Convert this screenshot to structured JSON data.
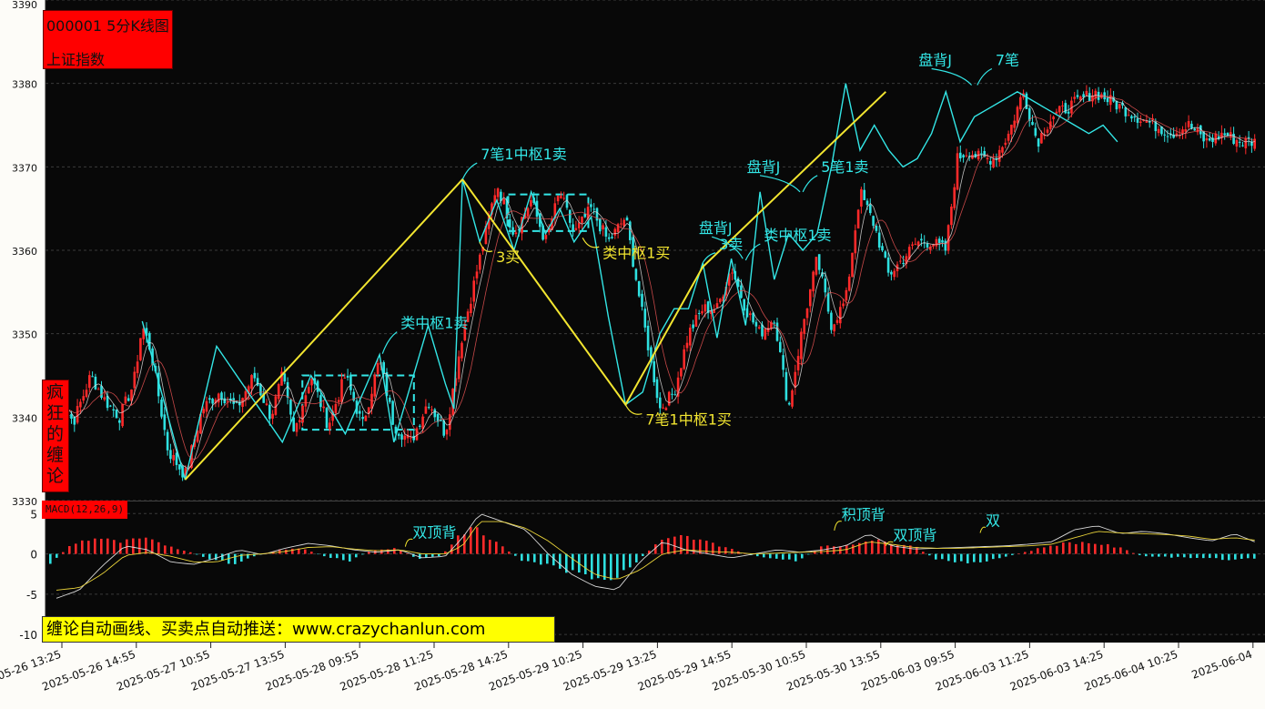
{
  "header": {
    "code_title": "000001 5分K线图",
    "index_name": "上证指数"
  },
  "side_label": "疯狂的缠论",
  "promo_text": "缠论自动画线、买卖点自动推送：www.crazychanlun.com",
  "macd_label": "MACD(12,26,9)",
  "colors": {
    "background": "#080808",
    "up": "#ff2a2a",
    "down": "#2ee0e0",
    "bi": "#33e6e6",
    "segment": "#f2e530",
    "label_red": "#ff0000",
    "promo_yellow": "#ffff00"
  },
  "chart_data": [
    {
      "type": "candlestick",
      "ylim": [
        3330,
        3390
      ],
      "yticks": [
        "3390",
        "3380",
        "3370",
        "3360",
        "3350",
        "3340",
        "3330"
      ],
      "xticks": [
        "2025-05-26 13:25",
        "2025-05-26 14:55",
        "2025-05-27 10:55",
        "2025-05-27 13:55",
        "2025-05-28 09:55",
        "2025-05-28 11:25",
        "2025-05-28 14:25",
        "2025-05-29 10:25",
        "2025-05-29 13:25",
        "2025-05-29 14:55",
        "2025-05-30 10:55",
        "2025-05-30 13:55",
        "2025-06-03 09:55",
        "2025-06-03 11:25",
        "2025-06-03 14:25",
        "2025-06-04 10:25",
        "2025-06-04"
      ],
      "price_path_x": [
        0,
        6,
        12,
        17,
        22,
        27,
        30,
        33,
        39,
        45,
        51,
        57,
        63,
        69,
        75,
        79,
        83,
        89,
        95,
        101,
        107,
        113,
        118,
        124,
        130,
        136,
        142,
        148,
        154,
        160,
        166,
        171,
        176,
        181,
        187,
        193,
        199,
        205,
        211,
        216,
        221,
        226,
        231,
        236,
        241,
        246,
        251,
        256,
        261,
        266,
        271,
        276,
        281,
        286,
        291,
        296,
        301,
        306,
        311,
        315,
        319,
        323,
        328,
        333,
        338,
        343,
        348,
        353,
        358,
        363,
        368,
        373,
        378,
        384,
        390,
        396,
        402,
        408,
        414,
        419
      ],
      "price_path_y": [
        3342,
        3339.5,
        3345,
        3342,
        3340,
        3344,
        3351,
        3348,
        3336,
        3333,
        3341,
        3343,
        3341,
        3345,
        3340,
        3345,
        3338,
        3345,
        3339,
        3345,
        3339,
        3347,
        3339,
        3337,
        3342,
        3338,
        3350,
        3359,
        3368,
        3362,
        3366,
        3361,
        3367,
        3362,
        3365,
        3361,
        3364,
        3352,
        3341,
        3343,
        3350,
        3353,
        3353,
        3358,
        3353,
        3350,
        3352,
        3341,
        3351,
        3359,
        3351,
        3354,
        3367,
        3363,
        3357,
        3359,
        3361,
        3361,
        3360,
        3371,
        3372,
        3371,
        3371,
        3374,
        3379,
        3373,
        3376,
        3377,
        3378,
        3379,
        3378,
        3377,
        3376,
        3375,
        3374,
        3375,
        3373,
        3374,
        3373,
        3373
      ],
      "bi_points_x": [
        30,
        45,
        56,
        79,
        89,
        101,
        113,
        118,
        130,
        136,
        139,
        142,
        148,
        154,
        160,
        166,
        171,
        176,
        181,
        187,
        193,
        199,
        205,
        211,
        216,
        221,
        226,
        231,
        236,
        241,
        246,
        251,
        256,
        261,
        266,
        271,
        276,
        281,
        286,
        291,
        296,
        301,
        306,
        311,
        316,
        321,
        326,
        331,
        336,
        341,
        346,
        351,
        356,
        361,
        366,
        371
      ],
      "bi_points_y": [
        3351.5,
        3332.5,
        3348.5,
        3337,
        3345,
        3338,
        3347.5,
        3337,
        3351,
        3344,
        3341,
        3368.5,
        3361,
        3366,
        3360,
        3367,
        3362,
        3365,
        3361,
        3364,
        3352,
        3341.5,
        3343,
        3350,
        3353,
        3353,
        3358.5,
        3349.5,
        3359,
        3351,
        3367,
        3356.5,
        3362,
        3360,
        3362,
        3370,
        3380,
        3372,
        3375,
        3372,
        3370,
        3371,
        3374,
        3379,
        3373,
        3376,
        3377,
        3378,
        3379,
        3378,
        3377,
        3376,
        3375,
        3374,
        3375,
        3373
      ],
      "segment_points_x": [
        45,
        142,
        199,
        226,
        290
      ],
      "segment_points_y": [
        3332.5,
        3368.5,
        3341.5,
        3358,
        3379
      ],
      "zones": [
        {
          "x0": 86,
          "x1": 125,
          "ylo": 3338.5,
          "yhi": 3345
        },
        {
          "x0": 158,
          "x1": 186,
          "ylo": 3362.3,
          "yhi": 3366.7
        }
      ],
      "annotations": [
        {
          "text": "类中枢1卖",
          "color": "cyan",
          "at_x": 114,
          "at_y": 3347.6
        },
        {
          "text": "7笔1中枢1卖",
          "color": "cyan",
          "at_x": 142,
          "at_y": 3368.5
        },
        {
          "text": "3买",
          "color": "yellow",
          "at_x": 148,
          "at_y": 3361
        },
        {
          "text": "类中枢1买",
          "color": "yellow",
          "at_x": 184,
          "at_y": 3361.5
        },
        {
          "text": "7笔1中枢1买",
          "color": "yellow",
          "at_x": 199,
          "at_y": 3341.5
        },
        {
          "text": "3卖",
          "color": "cyan",
          "at_x": 226,
          "at_y": 3358.5
        },
        {
          "text": "盘背J",
          "color": "cyan",
          "at_x": 240,
          "at_y": 3359
        },
        {
          "text": "类中枢1卖",
          "color": "cyan",
          "at_x": 241,
          "at_y": 3358.8
        },
        {
          "text": "盘背J",
          "color": "cyan",
          "at_x": 260,
          "at_y": 3367
        },
        {
          "text": "5笔1卖",
          "color": "cyan",
          "at_x": 261,
          "at_y": 3367
        },
        {
          "text": "盘背J",
          "color": "cyan",
          "at_x": 320,
          "at_y": 3379.8
        },
        {
          "text": "7笔",
          "color": "cyan",
          "at_x": 322,
          "at_y": 3379.8
        }
      ]
    },
    {
      "type": "macd",
      "title": "MACD(12,26,9)",
      "ylim": [
        -11,
        6.5
      ],
      "yticks": [
        "5",
        "0",
        "-5",
        "-10"
      ],
      "hist_x": [
        0,
        8,
        16,
        24,
        32,
        40,
        48,
        56,
        64,
        72,
        80,
        88,
        96,
        104,
        112,
        120,
        128,
        136,
        142,
        148,
        156,
        164,
        172,
        180,
        188,
        196,
        204,
        212,
        220,
        228,
        236,
        244,
        252,
        260,
        268,
        276,
        284,
        292,
        300,
        308,
        316,
        324,
        332,
        340,
        348,
        356,
        364,
        372,
        380,
        388,
        396,
        404,
        412,
        419
      ],
      "hist": [
        -1.2,
        1.4,
        2.1,
        1.5,
        2.0,
        1.2,
        0.3,
        -0.8,
        -1.3,
        -0.2,
        0.6,
        0.7,
        -0.4,
        -0.9,
        0.5,
        0.7,
        -0.6,
        -0.3,
        2.5,
        3.4,
        1.4,
        -0.9,
        -1.4,
        -2.2,
        -3.0,
        -3.5,
        -1.0,
        1.6,
        2.3,
        1.6,
        0.8,
        -0.2,
        -0.6,
        -1.0,
        0.9,
        1.1,
        1.8,
        1.5,
        1.2,
        -0.7,
        -1.0,
        -1.2,
        -0.4,
        0.3,
        1.1,
        1.5,
        1.4,
        0.8,
        -0.3,
        -0.4,
        -0.5,
        -0.6,
        -0.8,
        -0.6
      ],
      "dif": [
        -5.5,
        -4.5,
        -1.5,
        1.0,
        0.5,
        -1.0,
        -1.3,
        -0.5,
        0.5,
        -0.1,
        0.7,
        1.3,
        1.0,
        0.5,
        0.2,
        0.5,
        -0.5,
        -0.3,
        2.0,
        5.0,
        4.0,
        3.0,
        0.0,
        -2.5,
        -4.0,
        -4.5,
        -1.0,
        1.5,
        0.5,
        0.0,
        -0.5,
        0.0,
        0.5,
        0.2,
        0.5,
        1.0,
        2.5,
        1.0,
        0.6,
        0.7,
        0.8,
        0.9,
        1.0,
        1.2,
        1.5,
        3.0,
        3.5,
        2.5,
        2.8,
        2.5,
        2.0,
        1.6,
        2.5,
        1.5
      ],
      "dea": [
        -4.5,
        -4.2,
        -2.5,
        -0.2,
        0.2,
        -0.3,
        -1.0,
        -1.0,
        -0.2,
        0.0,
        0.3,
        0.8,
        0.9,
        0.6,
        0.4,
        0.5,
        0.0,
        0.0,
        1.0,
        4.0,
        4.0,
        3.2,
        1.6,
        -0.5,
        -2.5,
        -3.2,
        -2.0,
        0.0,
        0.5,
        0.3,
        0.2,
        0.0,
        0.1,
        0.2,
        0.3,
        0.5,
        1.5,
        1.2,
        0.8,
        0.7,
        0.7,
        0.8,
        0.9,
        1.0,
        1.2,
        2.0,
        2.8,
        2.6,
        2.5,
        2.4,
        2.2,
        1.8,
        2.0,
        1.7
      ],
      "annotations": [
        {
          "text": "双顶背",
          "at_x": 122,
          "at_y": 0.9
        },
        {
          "text": "积顶背",
          "at_x": 272,
          "at_y": 2.9
        },
        {
          "text": "双顶背",
          "at_x": 290,
          "at_y": 1.0
        },
        {
          "text": "双",
          "at_x": 323,
          "at_y": 2.6
        }
      ]
    }
  ]
}
